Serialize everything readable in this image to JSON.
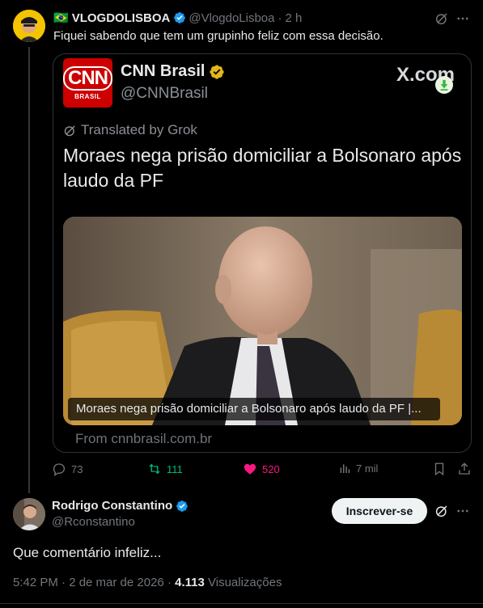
{
  "tweet1": {
    "flag": "🇧🇷",
    "name": "VLOGDOLISBOA",
    "handle": "@VlogdoLisboa",
    "separator": "·",
    "time": "2 h",
    "text": "Fiquei sabendo que tem um grupinho feliz com essa decisão."
  },
  "quote": {
    "logo_text": "CNN",
    "logo_subtext": "BRASIL",
    "name": "CNN Brasil",
    "handle": "@CNNBrasil",
    "brand": "X.com",
    "translated_label": "Translated by Grok",
    "headline": "Moraes nega prisão domiciliar a Bolsonaro após laudo da PF",
    "image_caption": "Moraes nega prisão domiciliar a Bolsonaro após laudo da PF |...",
    "source": "From cnnbrasil.com.br"
  },
  "actions": {
    "replies": "73",
    "reposts": "111",
    "likes": "520",
    "views": "7 mil"
  },
  "tweet2": {
    "name": "Rodrigo Constantino",
    "handle": "@Rconstantino",
    "subscribe_label": "Inscrever-se",
    "text": "Que comentário infeliz...",
    "timestamp": "5:42 PM · 2 de mar de 2026 ·",
    "view_count": "4.113",
    "views_label": "Visualizações"
  },
  "colors": {
    "background": "#000000",
    "verified": "#1d9bf0",
    "repost": "#00ba7c",
    "like": "#f91880",
    "cnn_red": "#cc0000"
  },
  "icons": [
    "grok-icon",
    "more-icon",
    "verified-badge-icon",
    "download-icon",
    "reply-icon",
    "repost-icon",
    "like-icon",
    "views-icon",
    "bookmark-icon",
    "share-icon"
  ]
}
